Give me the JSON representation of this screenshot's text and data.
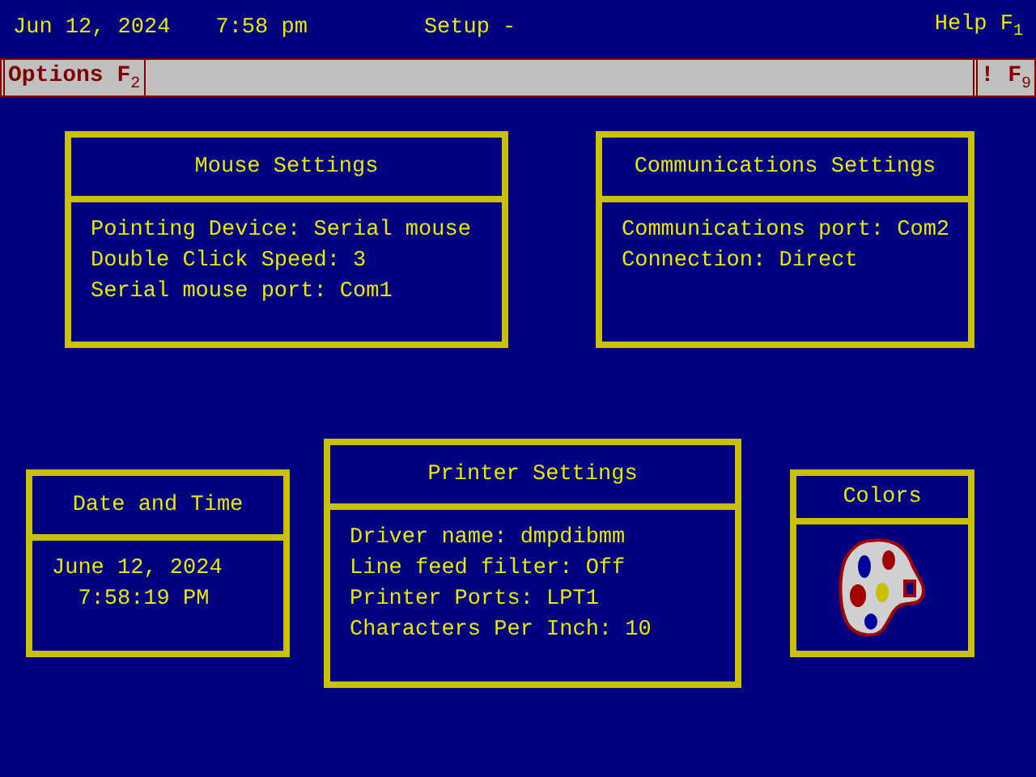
{
  "title_bar": {
    "date": "Jun 12, 2024",
    "time": "7:58 pm",
    "title": "Setup -",
    "help": "Help F$_{1}$"
  },
  "menu_bar": {
    "left": "Options F$_{2}$",
    "right": "! F$_{9}$"
  },
  "panels": [
    {
      "title": "Mouse Settings",
      "kind": "lines",
      "lines": [
        "Pointing Device: Serial mouse",
        "Double Click Speed: 3",
        "Serial mouse port: Com1"
      ]
    },
    {
      "title": "Communications Settings",
      "kind": "lines",
      "lines": [
        "Communications port: Com2",
        "Connection: Direct"
      ]
    },
    {
      "title": "Date and Time",
      "kind": "lines",
      "lines": [
        "June 12, 2024",
        "  7:58:19 PM"
      ]
    },
    {
      "title": "Printer Settings",
      "kind": "lines",
      "lines": [
        "Driver name: dmpdibmm",
        "Line feed filter: Off",
        "Printer Ports: LPT1",
        "Characters Per Inch: 10"
      ]
    },
    {
      "title": "Colors",
      "kind": "palette"
    }
  ]
}
